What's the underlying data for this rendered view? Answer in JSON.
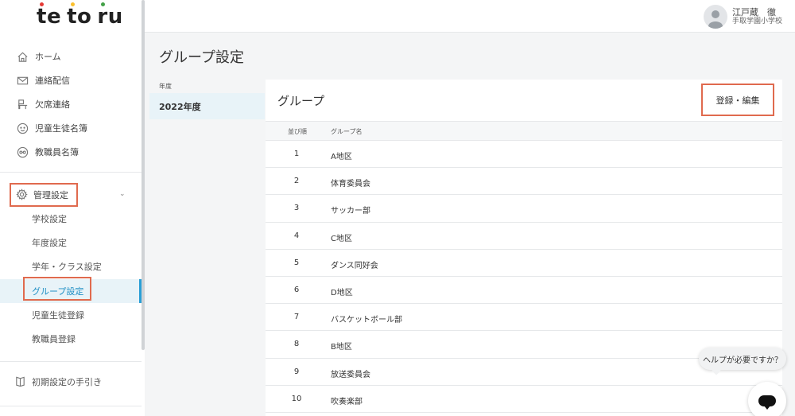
{
  "logo": {
    "letters": [
      "t",
      "e",
      "t",
      "o",
      "r",
      "u"
    ],
    "dot_colors": [
      "#e53935",
      "#fbc02d",
      "#43a047"
    ]
  },
  "sidebar": {
    "items": [
      {
        "label": "ホーム",
        "icon": "home-icon"
      },
      {
        "label": "連絡配信",
        "icon": "mail-icon"
      },
      {
        "label": "欠席連絡",
        "icon": "desk-icon"
      },
      {
        "label": "児童生徒名簿",
        "icon": "smile-icon"
      },
      {
        "label": "教職員名簿",
        "icon": "glasses-icon"
      }
    ],
    "admin": {
      "label": "管理設定",
      "icon": "gear-icon"
    },
    "admin_items": [
      {
        "label": "学校設定"
      },
      {
        "label": "年度設定"
      },
      {
        "label": "学年・クラス設定"
      },
      {
        "label": "グループ設定"
      },
      {
        "label": "児童生徒登録"
      },
      {
        "label": "教職員登録"
      }
    ],
    "guide": {
      "label": "初期設定の手引き",
      "icon": "book-icon"
    }
  },
  "header": {
    "user_name": "江戸蔵　徹",
    "school": "手取学園小学校"
  },
  "main": {
    "page_title": "グループ設定",
    "year_header": "年度",
    "year": "2022年度",
    "panel_title": "グループ",
    "edit_button": "登録・編集",
    "columns": {
      "order": "並び順",
      "name": "グループ名"
    },
    "rows": [
      {
        "order": "1",
        "name": "A地区"
      },
      {
        "order": "2",
        "name": "体育委員会"
      },
      {
        "order": "3",
        "name": "サッカー部"
      },
      {
        "order": "4",
        "name": "C地区"
      },
      {
        "order": "5",
        "name": "ダンス同好会"
      },
      {
        "order": "6",
        "name": "D地区"
      },
      {
        "order": "7",
        "name": "バスケットボール部"
      },
      {
        "order": "8",
        "name": "B地区"
      },
      {
        "order": "9",
        "name": "放送委員会"
      },
      {
        "order": "10",
        "name": "吹奏楽部"
      }
    ]
  },
  "help": {
    "bubble": "ヘルプが必要ですか？"
  },
  "colors": {
    "accent": "#2a9fd6",
    "highlight": "#e06a4e"
  }
}
